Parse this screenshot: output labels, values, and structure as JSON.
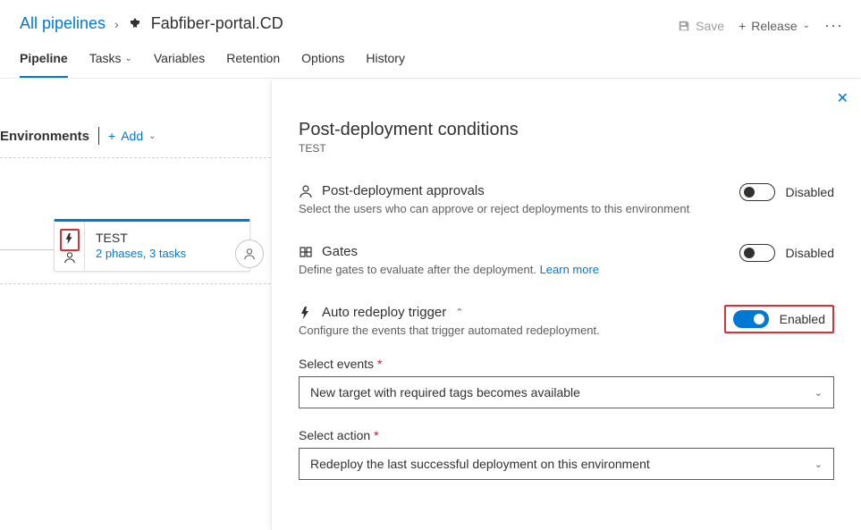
{
  "breadcrumb": {
    "root": "All pipelines",
    "current": "Fabfiber-portal.CD"
  },
  "top_actions": {
    "save": "Save",
    "release": "Release"
  },
  "tabs": {
    "pipeline": "Pipeline",
    "tasks": "Tasks",
    "variables": "Variables",
    "retention": "Retention",
    "options": "Options",
    "history": "History"
  },
  "environments": {
    "label": "Environments",
    "add": "Add"
  },
  "stage": {
    "name": "TEST",
    "meta": "2 phases, 3 tasks"
  },
  "panel": {
    "title": "Post-deployment conditions",
    "subtitle": "TEST",
    "approvals": {
      "title": "Post-deployment approvals",
      "desc": "Select the users who can approve or reject deployments to this environment",
      "state": "Disabled"
    },
    "gates": {
      "title": "Gates",
      "desc_pre": "Define gates to evaluate after the deployment. ",
      "learn": "Learn more",
      "state": "Disabled"
    },
    "redeploy": {
      "title": "Auto redeploy trigger",
      "desc": "Configure the events that trigger automated redeployment.",
      "state": "Enabled"
    },
    "events": {
      "label": "Select events",
      "value": "New target with required tags becomes available"
    },
    "action": {
      "label": "Select action",
      "value": "Redeploy the last successful deployment on this environment"
    }
  }
}
